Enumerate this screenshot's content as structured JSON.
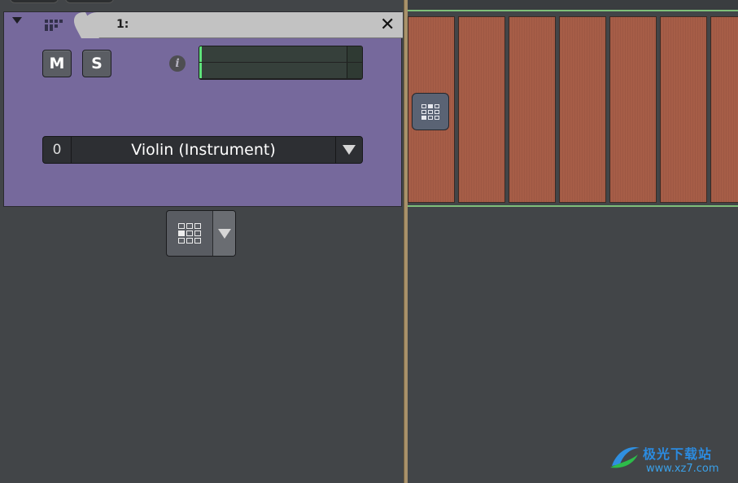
{
  "track": {
    "name": "1:",
    "mute_label": "M",
    "solo_label": "S",
    "info_label": "i",
    "close_label": "✕",
    "meter_level": 0.0,
    "instrument": {
      "number": "0",
      "name": "Violin (Instrument)"
    }
  },
  "add_track": {
    "icon": "grid-icon",
    "arrow_icon": "chevron-down-icon"
  },
  "timeline": {
    "clip_count": 7,
    "clip_color": "#a65d47",
    "region_marker_color": "#7fbf7a"
  },
  "colors": {
    "track_header": "#76699c",
    "background": "#424548",
    "divider": "#a8916a"
  },
  "watermark": {
    "title": "极光下载站",
    "url": "www.xz7.com"
  }
}
